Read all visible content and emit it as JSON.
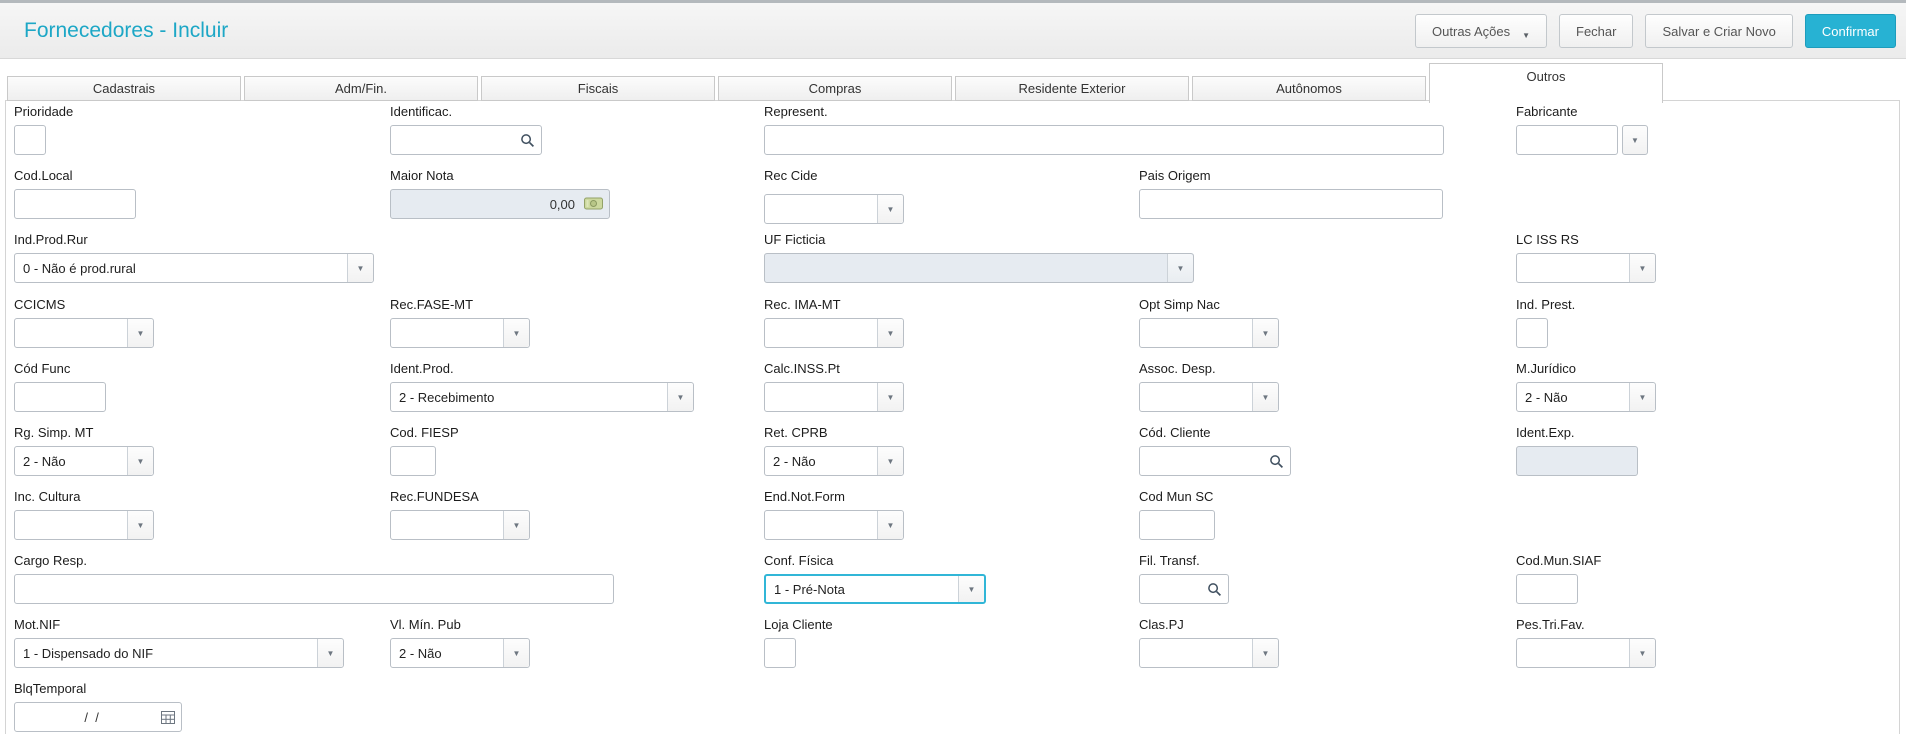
{
  "window": {
    "title": "Fornecedores - Incluir"
  },
  "toolbar": {
    "outras_acoes": "Outras Ações",
    "fechar": "Fechar",
    "salvar_e_criar_novo": "Salvar e Criar Novo",
    "confirmar": "Confirmar"
  },
  "tabs": {
    "items": [
      {
        "label": "Cadastrais"
      },
      {
        "label": "Adm/Fin."
      },
      {
        "label": "Fiscais"
      },
      {
        "label": "Compras"
      },
      {
        "label": "Residente Exterior"
      },
      {
        "label": "Autônomos"
      },
      {
        "label": "Outros"
      }
    ],
    "active": "Outros"
  },
  "icons": {
    "dropdown_arrow": "▼"
  },
  "colors": {
    "accent": "#1da7c6",
    "confirm_bg": "#27b2d3",
    "focus_border": "#31b6d7",
    "disabled_bg": "#e6ebf1"
  },
  "fields": {
    "prioridade": {
      "label": "Prioridade",
      "value": ""
    },
    "identificac": {
      "label": "Identificac.",
      "value": ""
    },
    "represent": {
      "label": "Represent.",
      "value": ""
    },
    "fabricante": {
      "label": "Fabricante",
      "value": ""
    },
    "cod_local": {
      "label": "Cod.Local",
      "value": ""
    },
    "maior_nota": {
      "label": "Maior Nota",
      "value": "0,00"
    },
    "rec_cide": {
      "label": "Rec Cide",
      "value": ""
    },
    "pais_origem": {
      "label": "Pais Origem",
      "value": ""
    },
    "ind_prod_rur": {
      "label": "Ind.Prod.Rur",
      "value": "0 - Não é prod.rural"
    },
    "uf_ficticia": {
      "label": "UF Ficticia",
      "value": ""
    },
    "lc_iss_rs": {
      "label": "LC ISS RS",
      "value": ""
    },
    "ccicms": {
      "label": "CCICMS",
      "value": ""
    },
    "rec_fase_mt": {
      "label": "Rec.FASE-MT",
      "value": ""
    },
    "rec_ima_mt": {
      "label": "Rec. IMA-MT",
      "value": ""
    },
    "opt_simp_nac": {
      "label": "Opt Simp Nac",
      "value": ""
    },
    "ind_prest": {
      "label": "Ind. Prest.",
      "value": ""
    },
    "cod_func": {
      "label": "Cód Func",
      "value": ""
    },
    "ident_prod": {
      "label": "Ident.Prod.",
      "value": "2 - Recebimento"
    },
    "calc_inss_pt": {
      "label": "Calc.INSS.Pt",
      "value": ""
    },
    "assoc_desp": {
      "label": "Assoc. Desp.",
      "value": ""
    },
    "m_juridico": {
      "label": "M.Jurídico",
      "value": "2 - Não"
    },
    "rg_simp_mt": {
      "label": "Rg. Simp. MT",
      "value": "2 - Não"
    },
    "cod_fiesp": {
      "label": "Cod. FIESP",
      "value": ""
    },
    "ret_cprb": {
      "label": "Ret. CPRB",
      "value": "2 - Não"
    },
    "cod_cliente": {
      "label": "Cód. Cliente",
      "value": ""
    },
    "ident_exp": {
      "label": "Ident.Exp.",
      "value": ""
    },
    "inc_cultura": {
      "label": "Inc. Cultura",
      "value": ""
    },
    "rec_fundesa": {
      "label": "Rec.FUNDESA",
      "value": ""
    },
    "end_not_form": {
      "label": "End.Not.Form",
      "value": ""
    },
    "cod_mun_sc": {
      "label": "Cod Mun SC",
      "value": ""
    },
    "cargo_resp": {
      "label": "Cargo Resp.",
      "value": ""
    },
    "conf_fisica": {
      "label": "Conf. Física",
      "value": "1 - Pré-Nota"
    },
    "fil_transf": {
      "label": "Fil. Transf.",
      "value": ""
    },
    "cod_mun_siaf": {
      "label": "Cod.Mun.SIAF",
      "value": ""
    },
    "mot_nif": {
      "label": "Mot.NIF",
      "value": "1 - Dispensado do NIF"
    },
    "vl_min_pub": {
      "label": "Vl. Mín. Pub",
      "value": "2 - Não"
    },
    "loja_cliente": {
      "label": "Loja Cliente",
      "value": ""
    },
    "clas_pj": {
      "label": "Clas.PJ",
      "value": ""
    },
    "pes_tri_fav": {
      "label": "Pes.Tri.Fav.",
      "value": ""
    },
    "blq_temporal": {
      "label": "BlqTemporal",
      "value": "  /  /"
    }
  }
}
